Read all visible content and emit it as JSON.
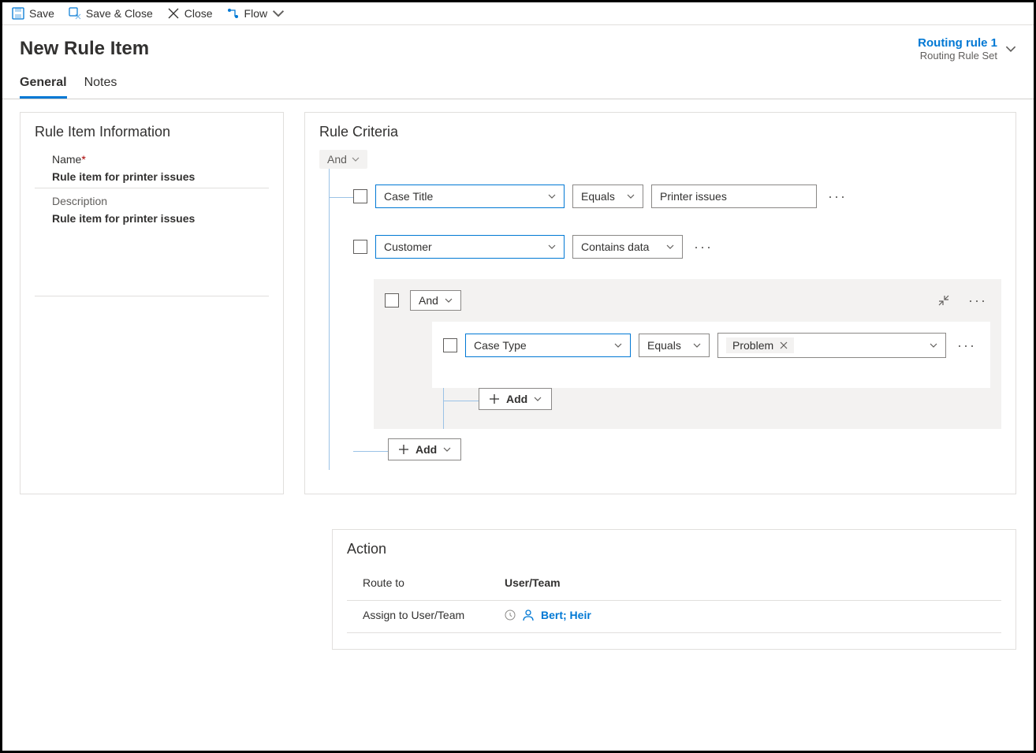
{
  "toolbar": {
    "save": "Save",
    "save_close": "Save & Close",
    "close": "Close",
    "flow": "Flow"
  },
  "header": {
    "title": "New Rule Item",
    "routing_rule_link": "Routing rule 1",
    "routing_rule_sub": "Routing Rule Set"
  },
  "tabs": {
    "general": "General",
    "notes": "Notes"
  },
  "info": {
    "section_title": "Rule Item Information",
    "name_label": "Name",
    "name_value": "Rule item for printer issues",
    "desc_label": "Description",
    "desc_value": "Rule item for printer issues"
  },
  "criteria": {
    "title": "Rule Criteria",
    "and_label": "And",
    "rows": [
      {
        "field": "Case Title",
        "operator": "Equals",
        "value": "Printer issues"
      },
      {
        "field": "Customer",
        "operator": "Contains data"
      }
    ],
    "nested": {
      "and_label": "And",
      "row": {
        "field": "Case Type",
        "operator": "Equals",
        "value": "Problem"
      },
      "add_label": "Add"
    },
    "add_label": "Add"
  },
  "action": {
    "title": "Action",
    "route_to_label": "Route to",
    "route_to_value": "User/Team",
    "assign_label": "Assign to User/Team",
    "assign_value": "Bert; Heir"
  }
}
